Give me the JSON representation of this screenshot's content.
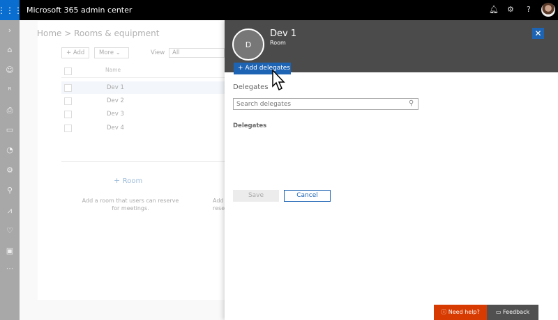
{
  "app": {
    "title": "Microsoft 365 admin center"
  },
  "topbar_icons": [
    "bell-icon",
    "gear-icon",
    "help-icon",
    "profile-avatar"
  ],
  "topbar": {
    "help_glyph": "?"
  },
  "rail_icons": [
    "chevron-right-icon",
    "home-icon",
    "user-icon",
    "group-icon",
    "printer-icon",
    "billing-icon",
    "support-icon",
    "settings-icon",
    "setup-wrench-icon",
    "reports-icon",
    "health-icon",
    "exchange-icon",
    "more-icon"
  ],
  "background": {
    "breadcrumb": "Home > Rooms & equipment",
    "add_label": "+ Add",
    "more_label": "More",
    "view_label": "View",
    "view_value": "All",
    "column_name": "Name",
    "rows": [
      "Dev 1",
      "Dev 2",
      "Dev 3",
      "Dev 4"
    ],
    "room_add": "Room",
    "room_desc": "Add a room that users can reserve for meetings.",
    "equip_desc_partial": "Add",
    "equip_desc_partial2": "rese"
  },
  "panel": {
    "avatar_initial": "D",
    "title": "Dev 1",
    "subtitle": "Room",
    "add_delegates": "Add delegates",
    "delegates_label": "Delegates",
    "search_placeholder": "Search delegates",
    "delegates_header": "Delegates",
    "save": "Save",
    "cancel": "Cancel"
  },
  "footer": {
    "help": "Need help?",
    "feedback": "Feedback"
  },
  "colors": {
    "accent": "#1e64b4",
    "help": "#d83b01",
    "header": "#4b4b4b"
  }
}
